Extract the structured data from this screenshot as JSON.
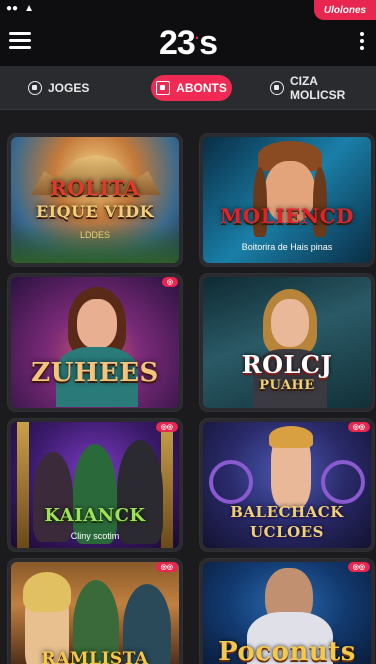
{
  "status": {
    "promo_label": "Ulolones"
  },
  "header": {
    "logo_text": "23",
    "logo_dot": "·",
    "logo_suffix": "s"
  },
  "tabs": [
    {
      "label": "JOGES",
      "active": false,
      "icon": "gamepad-icon"
    },
    {
      "label": "ABONTS",
      "active": true,
      "icon": "ticket-icon"
    },
    {
      "label": "CIZA MOLICSR",
      "active": false,
      "icon": "globe-icon"
    }
  ],
  "games": [
    {
      "title": "ROLITA",
      "title2": "EIQUE VIDK",
      "subtitle": "LDDES",
      "badge": ""
    },
    {
      "title": "MOLIENCD",
      "title2": "",
      "subtitle": "Boitorira de Hais pinas",
      "badge": ""
    },
    {
      "title": "ZUHEES",
      "title2": "",
      "subtitle": "",
      "badge": "◎"
    },
    {
      "title": "ROLCJ",
      "title2": "PUAHE",
      "subtitle": "",
      "badge": ""
    },
    {
      "title": "KAIANCK",
      "title2": "",
      "subtitle": "Cliny scotim",
      "badge": "◎◎"
    },
    {
      "title": "BALECHACK",
      "title2": "UCLOES",
      "subtitle": "",
      "badge": "◎◎"
    },
    {
      "title": "RAMLISTA",
      "title2": "",
      "subtitle": "",
      "badge": "◎◎"
    },
    {
      "title": "Poconuts",
      "title2": "",
      "subtitle": "",
      "badge": "◎◎"
    }
  ],
  "colors": {
    "accent": "#ef2b55",
    "header_bg": "#0e0e10",
    "tabs_bg": "#2a2b2f",
    "page_bg": "#1b1b1e"
  }
}
